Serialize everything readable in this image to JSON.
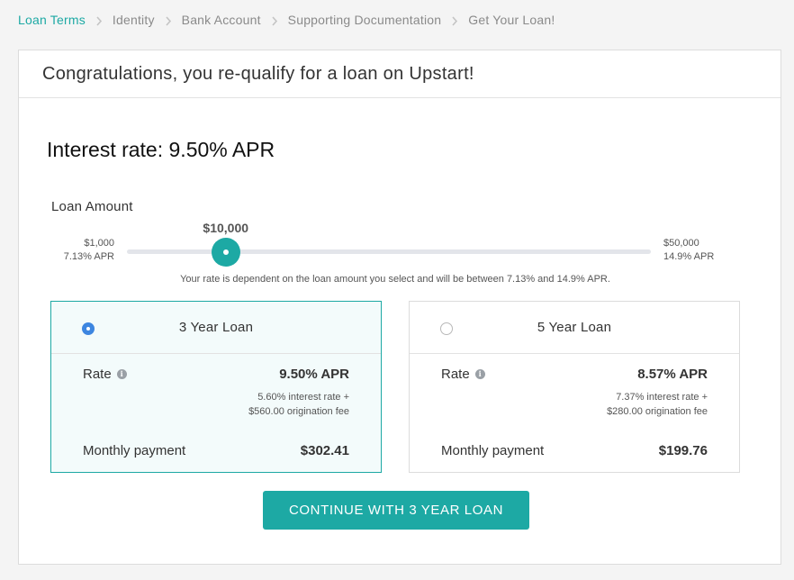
{
  "breadcrumb": {
    "steps": [
      "Loan Terms",
      "Identity",
      "Bank Account",
      "Supporting Documentation",
      "Get Your Loan!"
    ],
    "active_index": 0,
    "separator_icon": "chevron-right-icon"
  },
  "header": {
    "title": "Congratulations, you re-qualify for a loan on Upstart!"
  },
  "interest_rate": {
    "text": "Interest rate: 9.50% APR"
  },
  "loan_amount": {
    "label": "Loan Amount",
    "min_amount": "$1,000",
    "min_apr": "7.13% APR",
    "max_amount": "$50,000",
    "max_apr": "14.9% APR",
    "selected_label": "$10,000",
    "selected_value": 10000,
    "min_value": 1000,
    "max_value": 50000,
    "note": "Your rate is dependent on the loan amount you select and will be between 7.13% and 14.9% APR."
  },
  "options": [
    {
      "title": "3 Year Loan",
      "selected": true,
      "rate_label": "Rate",
      "apr": "9.50% APR",
      "interest_detail": "5.60% interest rate +",
      "fee_detail": "$560.00 origination fee",
      "monthly_label": "Monthly payment",
      "monthly_value": "$302.41"
    },
    {
      "title": "5 Year Loan",
      "selected": false,
      "rate_label": "Rate",
      "apr": "8.57% APR",
      "interest_detail": "7.37% interest rate +",
      "fee_detail": "$280.00 origination fee",
      "monthly_label": "Monthly payment",
      "monthly_value": "$199.76"
    }
  ],
  "cta": {
    "label": "CONTINUE WITH 3 YEAR LOAN"
  },
  "colors": {
    "accent": "#1da9a4",
    "radio_selected": "#3d86e0",
    "selected_card_bg": "#f3fbfb"
  }
}
